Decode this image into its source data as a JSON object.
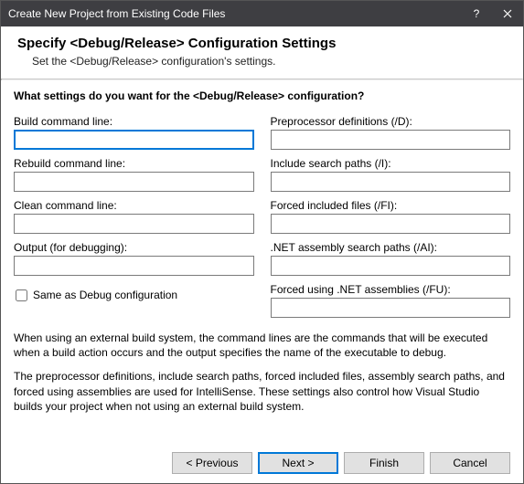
{
  "titlebar": {
    "title": "Create New Project from Existing Code Files"
  },
  "header": {
    "heading": "Specify <Debug/Release> Configuration Settings",
    "sub": "Set the <Debug/Release> configuration's settings."
  },
  "prompt": "What settings do you want for the <Debug/Release> configuration?",
  "left": {
    "build_label": "Build command line:",
    "build_value": "",
    "rebuild_label": "Rebuild command line:",
    "rebuild_value": "",
    "clean_label": "Clean command line:",
    "clean_value": "",
    "output_label": "Output (for debugging):",
    "output_value": "",
    "checkbox_label": "Same as Debug configuration"
  },
  "right": {
    "prep_label": "Preprocessor definitions (/D):",
    "prep_value": "",
    "incl_label": "Include search paths (/I):",
    "incl_value": "",
    "forced_label": "Forced included files (/FI):",
    "forced_value": "",
    "asm_label": ".NET assembly search paths (/AI):",
    "asm_value": "",
    "fu_label": "Forced using .NET assemblies (/FU):",
    "fu_value": ""
  },
  "description": {
    "p1": "When using an external build system, the command lines are the commands that will be executed when a build action occurs and the output specifies the name of the executable to debug.",
    "p2": "The preprocessor definitions, include search paths, forced included files, assembly search paths, and forced using assemblies are used for IntelliSense.  These settings also control how Visual Studio builds your project when not using an external build system."
  },
  "footer": {
    "prev": "< Previous",
    "next": "Next >",
    "finish": "Finish",
    "cancel": "Cancel"
  }
}
